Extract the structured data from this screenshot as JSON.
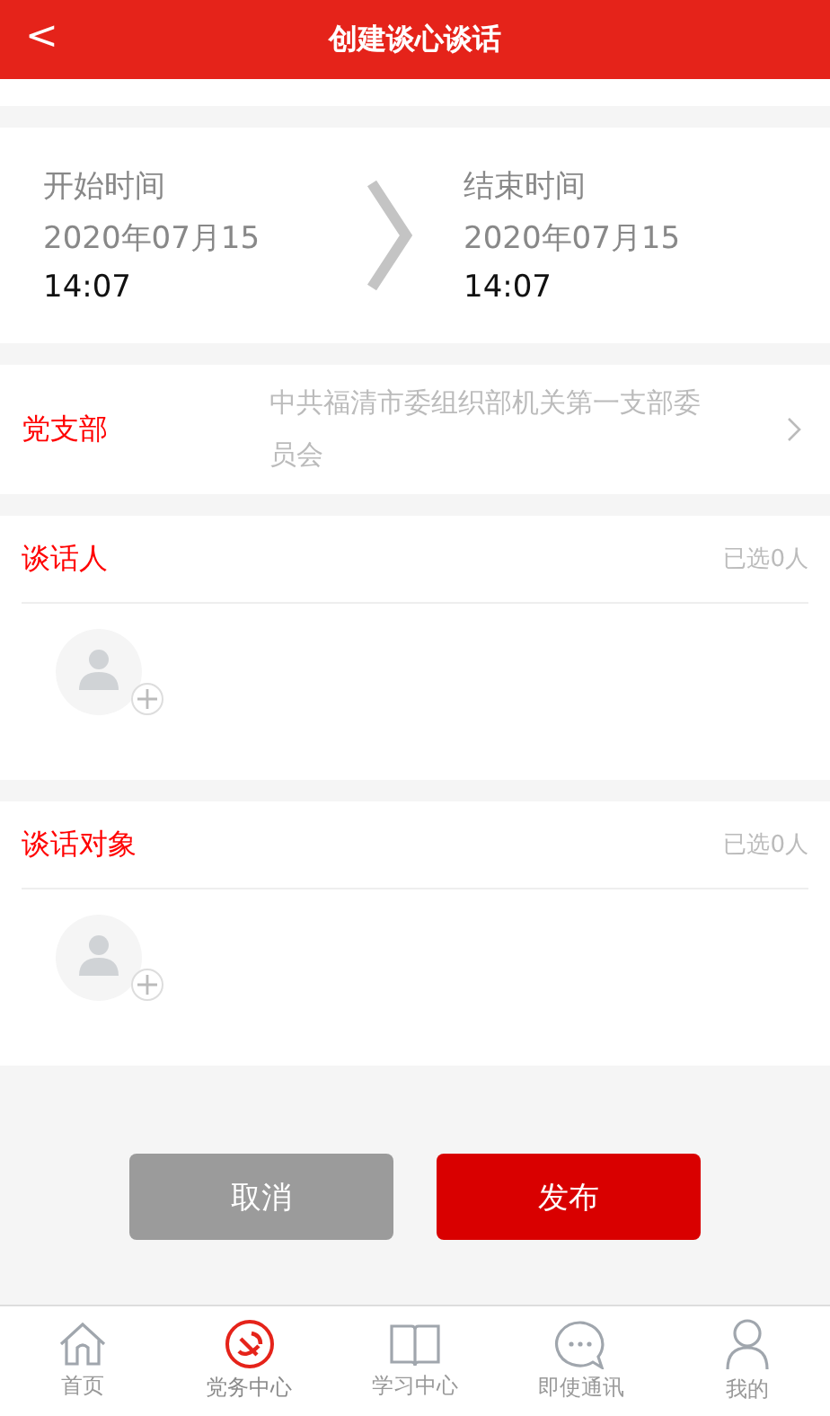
{
  "header": {
    "back": "<",
    "title": "创建谈心谈话"
  },
  "time_range": {
    "start": {
      "label": "开始时间",
      "date": "2020年07月15",
      "time": "14:07"
    },
    "end": {
      "label": "结束时间",
      "date": "2020年07月15",
      "time": "14:07"
    }
  },
  "branch": {
    "label": "党支部",
    "value": "中共福清市委组织部机关第一支部委员会"
  },
  "sections": [
    {
      "label": "谈话人",
      "count": "已选0人"
    },
    {
      "label": "谈话对象",
      "count": "已选0人"
    }
  ],
  "buttons": [
    {
      "label": "取消",
      "kind": "secondary"
    },
    {
      "label": "发布",
      "kind": "primary"
    }
  ],
  "tabs": [
    {
      "label": "首页",
      "kind": "home",
      "selected": false
    },
    {
      "label": "党务中心",
      "kind": "party",
      "selected": true
    },
    {
      "label": "学习中心",
      "kind": "book",
      "selected": false
    },
    {
      "label": "即使通讯",
      "kind": "chat",
      "selected": false
    },
    {
      "label": "我的",
      "kind": "person",
      "selected": false
    }
  ]
}
